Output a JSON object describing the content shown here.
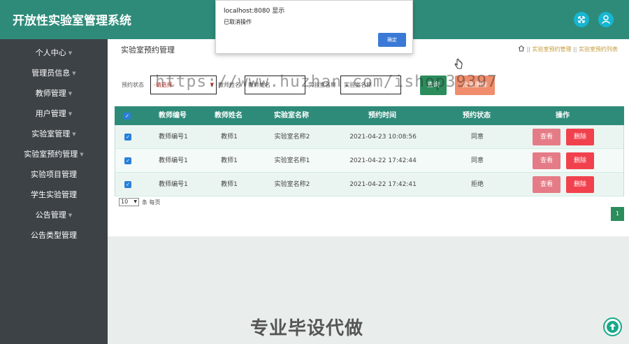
{
  "header": {
    "app_title": "开放性实验室管理系统"
  },
  "sidebar": {
    "items": [
      {
        "label": "个人中心",
        "has_caret": true
      },
      {
        "label": "管理员信息",
        "has_caret": true
      },
      {
        "label": "教师管理",
        "has_caret": true
      },
      {
        "label": "用户管理",
        "has_caret": true
      },
      {
        "label": "实验室管理",
        "has_caret": true
      },
      {
        "label": "实验室预约管理",
        "has_caret": true
      },
      {
        "label": "实验项目管理",
        "has_caret": false
      },
      {
        "label": "学生实验管理",
        "has_caret": false
      },
      {
        "label": "公告管理",
        "has_caret": true
      },
      {
        "label": "公告类型管理",
        "has_caret": false
      }
    ]
  },
  "page": {
    "title": "实验室预约管理",
    "breadcrumb": {
      "sep": "||",
      "level1": "实验室预约管理",
      "level2": "实验室预约列表"
    }
  },
  "filters": {
    "status_label": "预约状态",
    "status_value": "-请选择-",
    "teacher_label": "教师姓名",
    "teacher_placeholder": "教师姓名",
    "lab_label": "实验室名称",
    "lab_placeholder": "实验室名称",
    "query_button": "查询",
    "batch_delete_button": "批量删除"
  },
  "table": {
    "headers": [
      "教师编号",
      "教师姓名",
      "实验室名称",
      "预约时间",
      "预约状态",
      "操作"
    ],
    "rows": [
      {
        "teacher_id": "教师编号1",
        "teacher_name": "教师1",
        "lab_name": "实验室名称2",
        "time": "2021-04-23 10:08:56",
        "status": "同意"
      },
      {
        "teacher_id": "教师编号1",
        "teacher_name": "教师1",
        "lab_name": "实验室名称1",
        "time": "2021-04-22 17:42:44",
        "status": "同意"
      },
      {
        "teacher_id": "教师编号1",
        "teacher_name": "教师1",
        "lab_name": "实验室名称2",
        "time": "2021-04-22 17:42:41",
        "status": "拒绝"
      }
    ],
    "view_button": "查看",
    "delete_button": "删除"
  },
  "pagination": {
    "page_size": "10",
    "page_size_label": "条 每页",
    "current_page": "1"
  },
  "dialog": {
    "title": "localhost:8080 显示",
    "message": "已取消操作",
    "ok_button": "确定"
  },
  "overlay": {
    "watermark": "https://www.huzhan.com/ishop39397",
    "promo": "专业毕设代做"
  },
  "colors": {
    "primary": "#2e8b7a",
    "sidebar": "#3d4247",
    "view_button": "#e57b86",
    "delete_button": "#f1414d",
    "query_button": "#2b8c5c",
    "batch_delete": "#f08d6c"
  }
}
